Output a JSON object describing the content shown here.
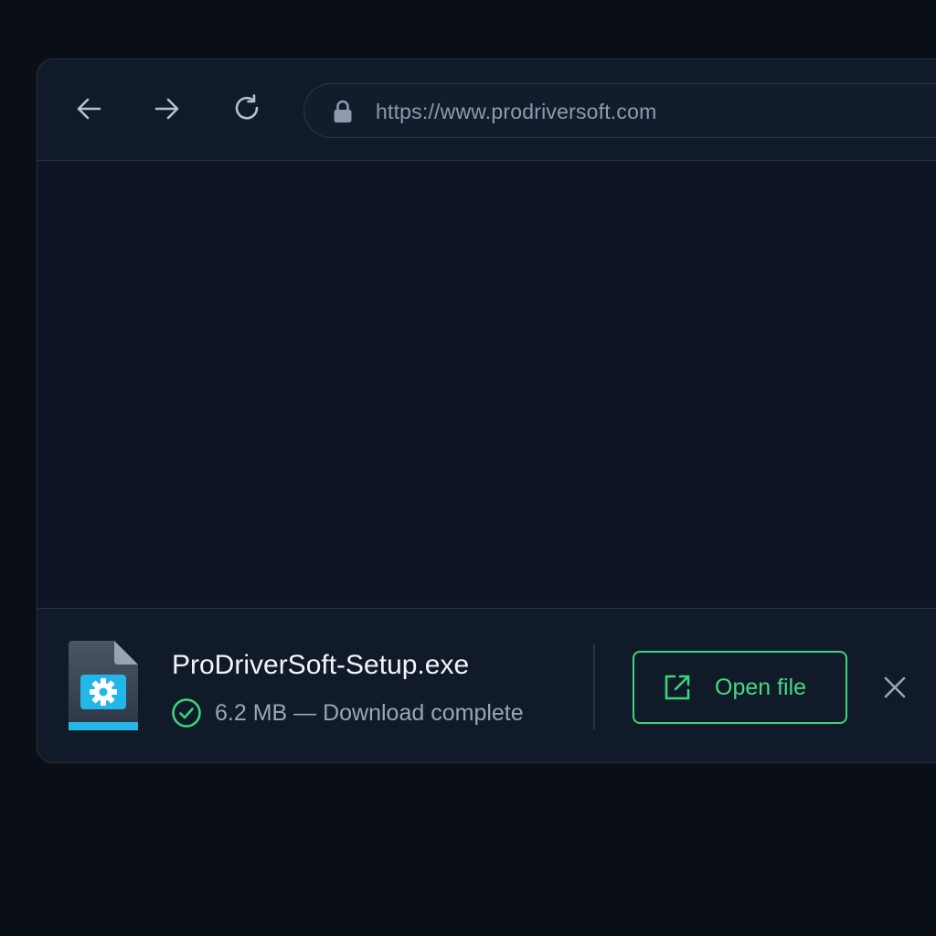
{
  "browser": {
    "url": "https://www.prodriversoft.com",
    "icons": {
      "back": "arrow-left-icon",
      "forward": "arrow-right-icon",
      "reload": "reload-icon",
      "lock": "lock-icon"
    }
  },
  "download": {
    "file_name": "ProDriverSoft-Setup.exe",
    "status": "6.2 MB — Download complete",
    "open_label": "Open file",
    "icons": {
      "file": "executable-file-icon",
      "status": "check-circle-icon",
      "open": "external-link-icon",
      "dismiss": "close-icon"
    }
  },
  "colors": {
    "background": "#0a0e17",
    "window": "#0e1525",
    "accent_green": "#3bd47a",
    "file_icon_accent": "#22b7e8"
  }
}
